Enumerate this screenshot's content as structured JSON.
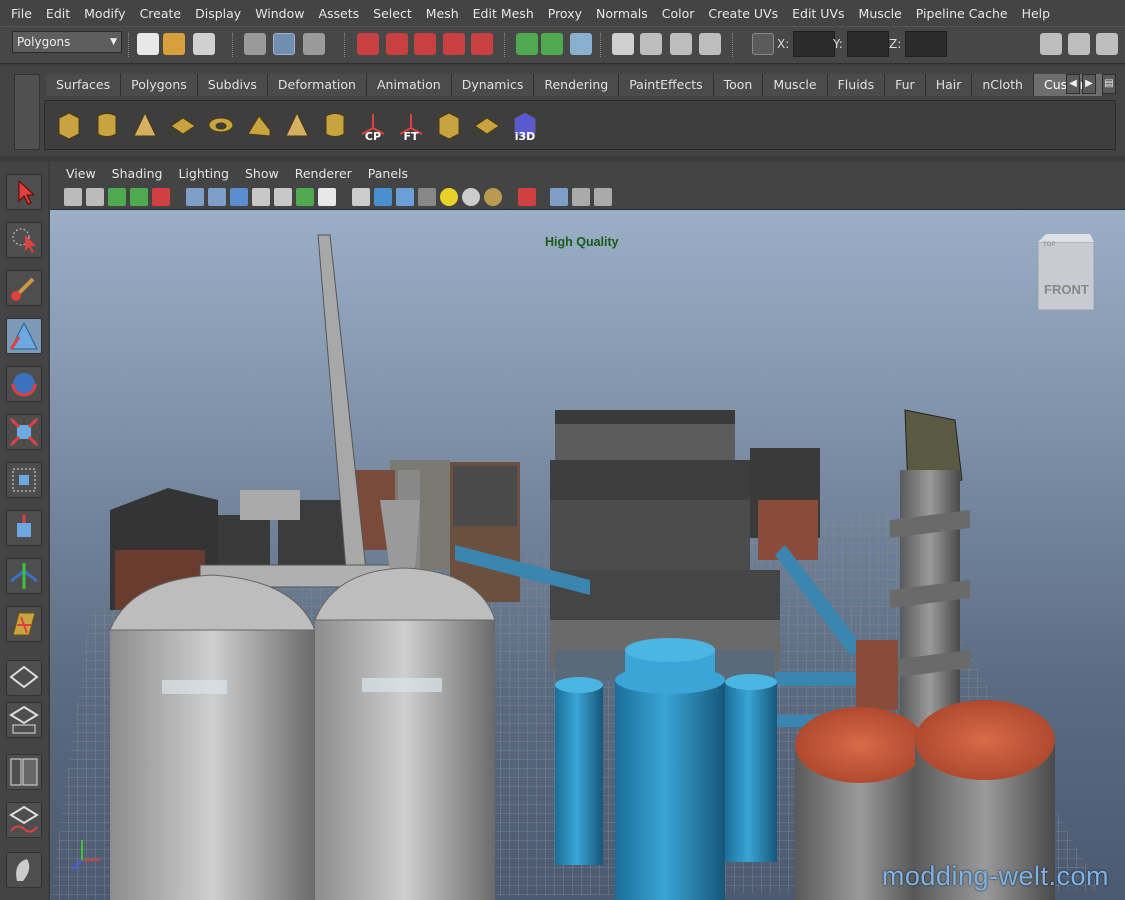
{
  "menubar": {
    "items": [
      "File",
      "Edit",
      "Modify",
      "Create",
      "Display",
      "Window",
      "Assets",
      "Select",
      "Mesh",
      "Edit Mesh",
      "Proxy",
      "Normals",
      "Color",
      "Create UVs",
      "Edit UVs",
      "Muscle",
      "Pipeline Cache",
      "Help"
    ]
  },
  "statusline": {
    "mode": "Polygons",
    "x_label": "X:",
    "y_label": "Y:",
    "z_label": "Z:"
  },
  "shelf": {
    "tabs": [
      "Surfaces",
      "Polygons",
      "Subdivs",
      "Deformation",
      "Animation",
      "Dynamics",
      "Rendering",
      "PaintEffects",
      "Toon",
      "Muscle",
      "Fluids",
      "Fur",
      "Hair",
      "nCloth",
      "Custom"
    ],
    "active_tab": "Custom",
    "icons": [
      {
        "name": "cube-icon",
        "label": ""
      },
      {
        "name": "cylinder-icon",
        "label": ""
      },
      {
        "name": "cone-icon",
        "label": ""
      },
      {
        "name": "plane-icon",
        "label": ""
      },
      {
        "name": "torus-icon",
        "label": ""
      },
      {
        "name": "prism-icon",
        "label": ""
      },
      {
        "name": "pyramid-icon",
        "label": ""
      },
      {
        "name": "pipe-icon",
        "label": ""
      },
      {
        "name": "center-pivot-icon",
        "label": "CP"
      },
      {
        "name": "freeze-transform-icon",
        "label": "FT"
      },
      {
        "name": "uv-cube-icon",
        "label": ""
      },
      {
        "name": "uv-plane-icon",
        "label": ""
      },
      {
        "name": "i3d-export-icon",
        "label": "i3D"
      }
    ]
  },
  "panel": {
    "menu": [
      "View",
      "Shading",
      "Lighting",
      "Show",
      "Renderer",
      "Panels"
    ]
  },
  "viewport": {
    "quality_label": "High Quality",
    "viewcube_face": "FRONT",
    "viewcube_top": "TOP",
    "watermark": "modding-welt.com",
    "axis_x": "x",
    "axis_y": "y",
    "axis_z": "z"
  },
  "colors": {
    "accent_active_tab": "#6e6e6e",
    "silo_blue": "#2e8fbf",
    "rust_top": "#c2553a",
    "watermark": "#7fb2e0",
    "hq_label": "#1a5a1a"
  }
}
